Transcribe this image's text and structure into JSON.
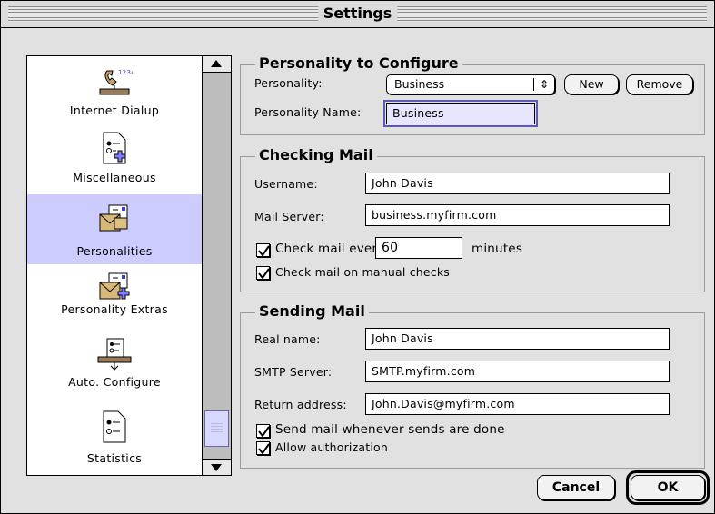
{
  "window": {
    "title": "Settings"
  },
  "sidebar": {
    "items": [
      {
        "label": "Internet Dialup",
        "icon": "phone-dialup-icon"
      },
      {
        "label": "Miscellaneous",
        "icon": "misc-document-icon"
      },
      {
        "label": "Personalities",
        "icon": "personalities-icon",
        "selected": true
      },
      {
        "label": "Personality Extras",
        "icon": "personality-extras-icon"
      },
      {
        "label": "Auto. Configure",
        "icon": "auto-configure-icon"
      },
      {
        "label": "Statistics",
        "icon": "statistics-icon"
      }
    ]
  },
  "personality_group": {
    "title": "Personality to Configure",
    "personality_label": "Personality:",
    "personality_value": "Business",
    "new_label": "New",
    "remove_label": "Remove",
    "name_label": "Personality Name:",
    "name_value": "Business"
  },
  "checking_group": {
    "title": "Checking Mail",
    "username_label": "Username:",
    "username_value": "John Davis",
    "server_label": "Mail Server:",
    "server_value": "business.myfirm.com",
    "check_every_label": "Check mail every",
    "check_every_value": "60",
    "minutes_label": "minutes",
    "manual_label": "Check mail on manual checks"
  },
  "sending_group": {
    "title": "Sending Mail",
    "realname_label": "Real name:",
    "realname_value": "John Davis",
    "smtp_label": "SMTP Server:",
    "smtp_value": "SMTP.myfirm.com",
    "return_label": "Return address:",
    "return_value": "John.Davis@myfirm.com",
    "send_when_label": "Send mail whenever sends are done",
    "auth_label": "Allow authorization"
  },
  "footer": {
    "cancel_label": "Cancel",
    "ok_label": "OK"
  },
  "colors": {
    "selection": "#ccccff",
    "window_bg": "#e1e1e1"
  }
}
